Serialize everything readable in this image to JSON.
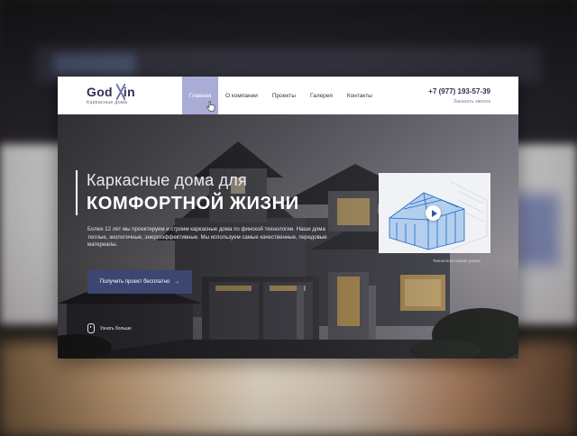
{
  "brand": {
    "logo_text": "God in",
    "tagline": "Каркасные  дома",
    "accent": "#2d3050",
    "highlight": "#a9acd6"
  },
  "nav": {
    "items": [
      {
        "label": "Главная",
        "active": true
      },
      {
        "label": "О компании"
      },
      {
        "label": "Проекты"
      },
      {
        "label": "Галерея"
      },
      {
        "label": "Контакты"
      }
    ]
  },
  "contact": {
    "phone": "+7 (977) 193-57-39",
    "callback": "Заказать звонок"
  },
  "hero": {
    "title_line1": "Каркасные дома для",
    "title_line2": "КОМФОРТНОЙ ЖИЗНИ",
    "description": "Более 12 лет мы проектируем и строим каркасные дома по финской технологии. Наши дома теплые, экологичные, энергоэффективные. Мы используем самые качественные, передовые материалы.",
    "cta_label": "Получить проект бесплатно",
    "cta_arrow": "→",
    "cta_color": "#3c4670",
    "more_label": "Узнать больше",
    "video_caption": "Технология наших домов",
    "icons": [
      "mouse-icon",
      "play-icon",
      "pointer-cursor-icon"
    ]
  }
}
